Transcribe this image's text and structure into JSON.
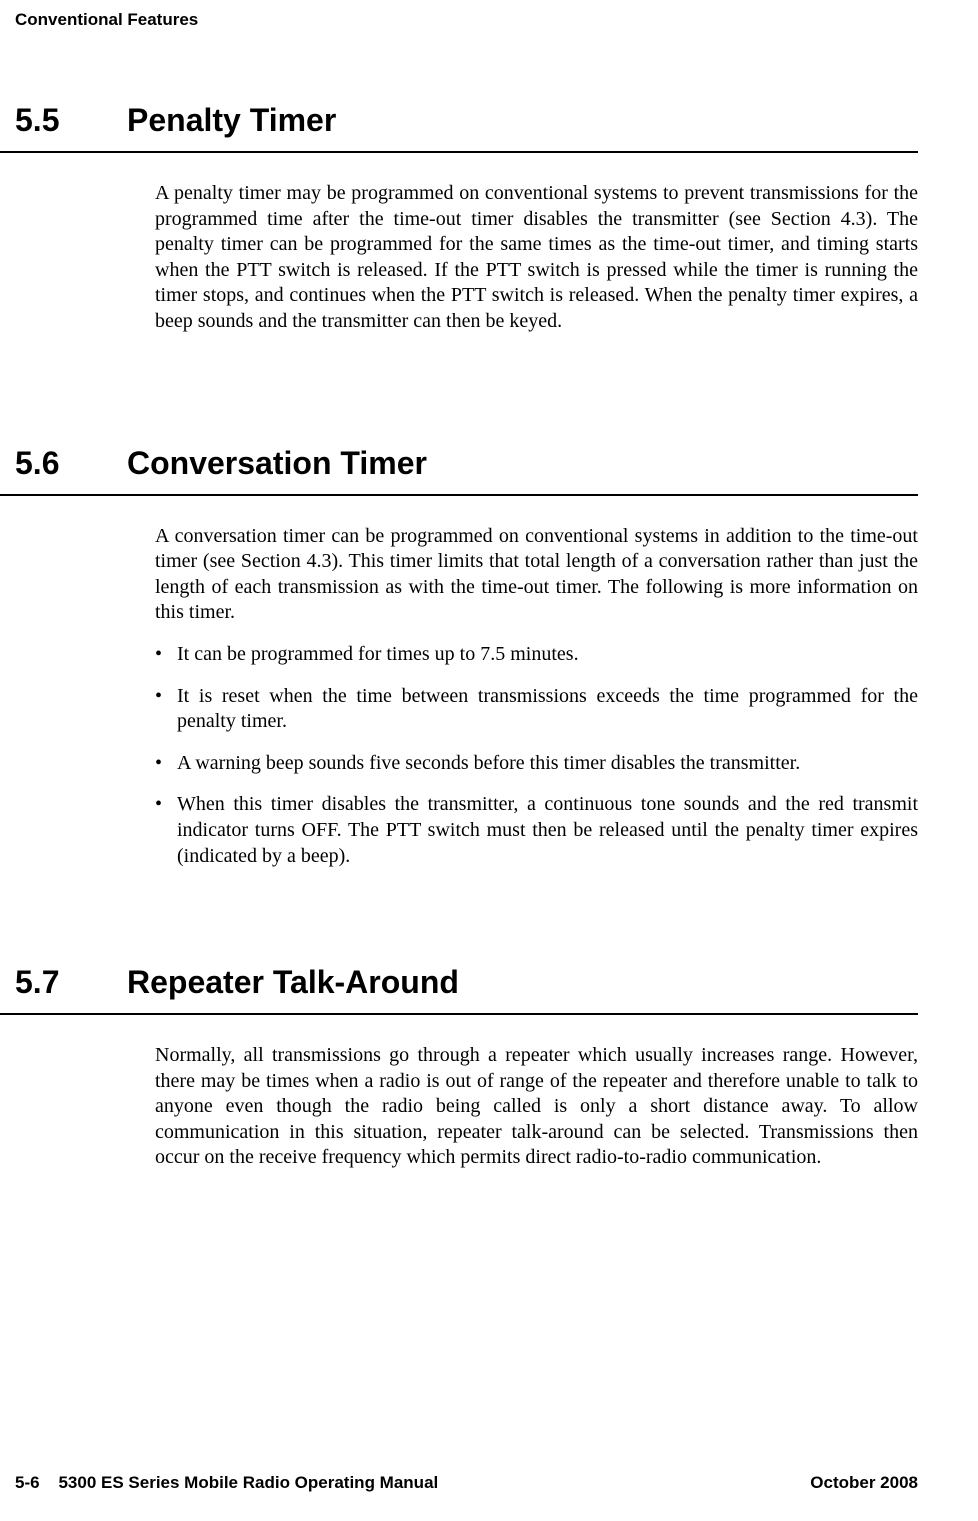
{
  "header": {
    "chapter_title": "Conventional Features"
  },
  "sections": [
    {
      "number": "5.5",
      "title": "Penalty Timer",
      "paragraphs": [
        "A penalty timer may be programmed on conventional systems to prevent transmissions for the programmed time after the time-out timer disables the transmitter (see Section 4.3). The penalty timer can be programmed for the same times as the time-out timer, and timing starts when the PTT switch is released. If the PTT switch is pressed while the timer is running the timer stops, and continues when the PTT switch is released. When the penalty timer expires, a beep sounds and the transmitter can then be keyed."
      ],
      "bullets": []
    },
    {
      "number": "5.6",
      "title": "Conversation Timer",
      "paragraphs": [
        "A conversation timer can be programmed on conventional systems in addition to the time-out timer (see Section 4.3). This timer limits that total length of a conversation rather than just the length of each transmission as with the time-out timer. The following is more information on this timer."
      ],
      "bullets": [
        "It can be programmed for times up to 7.5 minutes.",
        "It is reset when the time between transmissions exceeds the time programmed for the penalty timer.",
        "A warning beep sounds five seconds before this timer disables the transmitter.",
        "When this timer disables the transmitter, a continuous tone sounds and the red transmit indicator turns OFF. The PTT switch must then be released until the penalty timer expires (indicated by a beep)."
      ]
    },
    {
      "number": "5.7",
      "title": "Repeater Talk-Around",
      "paragraphs": [
        "Normally, all transmissions go through a repeater which usually increases range. However, there may be times when a radio is out of range of the repeater and therefore unable to talk to anyone even though the radio being called is only a short distance away. To allow communication in this situation, repeater talk-around can be selected. Transmissions then occur on the receive frequency which permits direct radio-to-radio communication."
      ],
      "bullets": []
    }
  ],
  "footer": {
    "left": "5-6    5300 ES Series Mobile Radio Operating Manual",
    "right": "October 2008"
  }
}
